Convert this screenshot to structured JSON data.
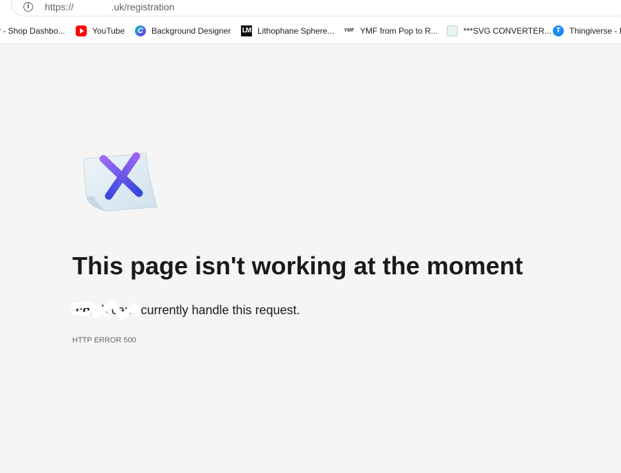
{
  "browser": {
    "url": "https://  .uk/registration",
    "url_prefix": "https://",
    "url_suffix": ".uk/registration"
  },
  "bookmarks": [
    {
      "label": "y - Shop Dashbo...",
      "icon": "store-icon"
    },
    {
      "label": "YouTube",
      "icon": "youtube-icon"
    },
    {
      "label": "Background Designer",
      "icon": "canva-icon"
    },
    {
      "label": "Lithophane Sphere...",
      "icon": "lm-icon"
    },
    {
      "label": "YMF from Pop to R...",
      "icon": "ymf-icon"
    },
    {
      "label": "***SVG CONVERTER...",
      "icon": "svg-converter-icon"
    },
    {
      "label": "Thingiverse - D",
      "icon": "thingiverse-icon"
    }
  ],
  "icons": {
    "youtube": "YT",
    "canva": "C",
    "lm": "LM",
    "ymf": "YMF",
    "thingiverse": "T"
  },
  "error": {
    "title": "This page isn't working at the moment",
    "host": ".co.uk",
    "message": " can't currently handle this request.",
    "code": "HTTP ERROR 500"
  },
  "colors": {
    "page_background": "#f5f5f5",
    "x_gradient_start": "#8b5cf6",
    "x_gradient_end": "#3b4fe0",
    "paper": "#dbe9f3"
  }
}
